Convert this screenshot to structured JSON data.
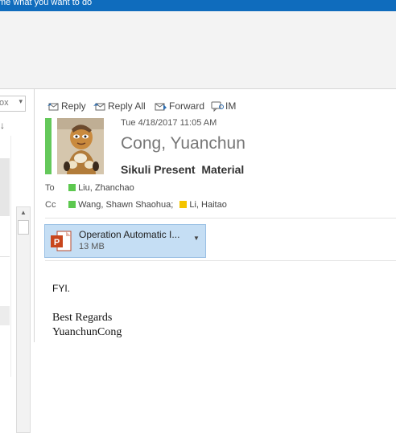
{
  "ribbon": {
    "tell_me": "me what you want to do"
  },
  "left_pane": {
    "filter_value": "ox",
    "sort_icon": "down-arrow-icon"
  },
  "toolbar": {
    "reply": "Reply",
    "reply_all": "Reply All",
    "forward": "Forward",
    "im": "IM"
  },
  "message": {
    "date": "Tue 4/18/2017 11:05 AM",
    "sender": "Cong, Yuanchun",
    "subject": "Sikuli Present  Material",
    "to_label": "To",
    "cc_label": "Cc",
    "to": [
      {
        "name": "Liu, Zhanchao",
        "color": "#5cc84e"
      }
    ],
    "cc": [
      {
        "name": "Wang, Shawn Shaohua;",
        "color": "#5cc84e"
      },
      {
        "name": "Li, Haitao",
        "color": "#f4c400"
      }
    ],
    "accent_color": "#64c85a"
  },
  "attachment": {
    "name": "Operation Automatic I...",
    "size": "13 MB",
    "icon": "powerpoint-icon"
  },
  "body": {
    "line1": "FYI.",
    "line2": "Best Regards",
    "line3": "YuanchunCong"
  }
}
